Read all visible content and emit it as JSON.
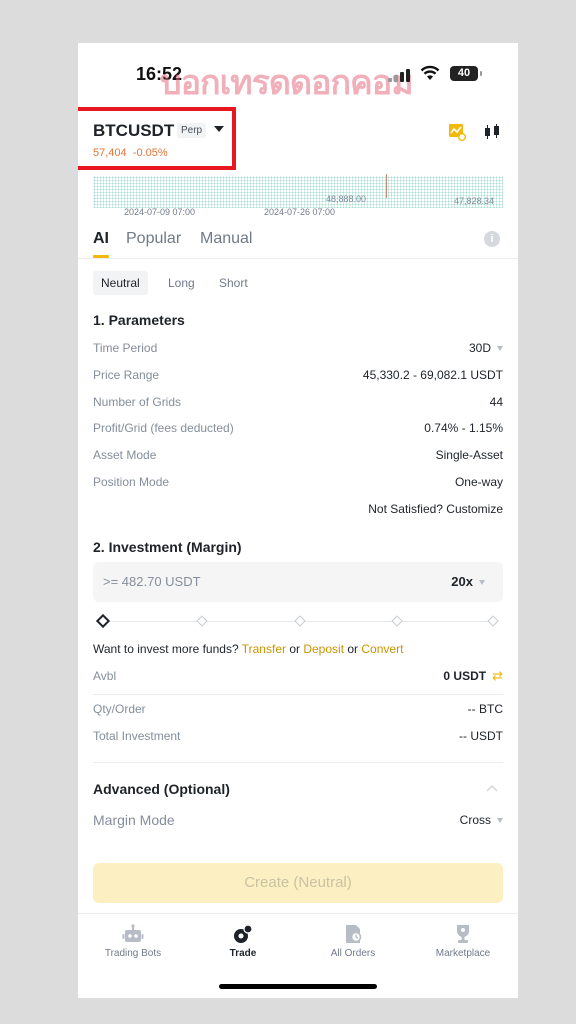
{
  "status_bar": {
    "time": "16:52",
    "battery": "40",
    "watermark": "บอกเทรดดอกคอม"
  },
  "pair": {
    "symbol": "BTCUSDT",
    "type_badge": "Perp",
    "price": "57,404",
    "change": "-0.05%"
  },
  "chart": {
    "date_start": "2024-07-09 07:00",
    "date_end": "2024-07-26 07:00",
    "mid_label": "48,888.00",
    "right_label": "47,828.34"
  },
  "tabs": [
    {
      "label": "AI"
    },
    {
      "label": "Popular"
    },
    {
      "label": "Manual"
    }
  ],
  "subtabs": [
    {
      "label": "Neutral"
    },
    {
      "label": "Long"
    },
    {
      "label": "Short"
    }
  ],
  "parameters": {
    "title": "1. Parameters",
    "rows": [
      {
        "label": "Time Period",
        "value": "30D"
      },
      {
        "label": "Price Range",
        "value": "45,330.2 - 69,082.1 USDT"
      },
      {
        "label": "Number of Grids",
        "value": "44"
      },
      {
        "label": "Profit/Grid (fees deducted)",
        "value": "0.74% - 1.15%"
      },
      {
        "label": "Asset Mode",
        "value": "Single-Asset"
      },
      {
        "label": "Position Mode",
        "value": "One-way"
      }
    ],
    "customize_link": "Not Satisfied? Customize"
  },
  "investment": {
    "title": "2. Investment (Margin)",
    "placeholder": ">= 482.70 USDT",
    "leverage": "20x",
    "slider_value": 0,
    "funds_prefix": "Want to invest more funds?",
    "transfer": "Transfer",
    "or1": "or",
    "deposit": "Deposit",
    "or2": "or",
    "convert": "Convert",
    "avbl_label": "Avbl",
    "avbl_value": "0 USDT",
    "qty_label": "Qty/Order",
    "qty_value": "-- BTC",
    "total_label": "Total Investment",
    "total_value": "-- USDT"
  },
  "advanced": {
    "title": "Advanced (Optional)",
    "margin_label": "Margin Mode",
    "margin_value": "Cross"
  },
  "create_button": "Create (Neutral)",
  "bottom_nav": [
    {
      "label": "Trading Bots"
    },
    {
      "label": "Trade"
    },
    {
      "label": "All Orders"
    },
    {
      "label": "Marketplace"
    }
  ],
  "colors": {
    "accent": "#f0b90b",
    "link": "#c99400",
    "price": "#e0753a",
    "highlight_box": "#e8161e"
  }
}
